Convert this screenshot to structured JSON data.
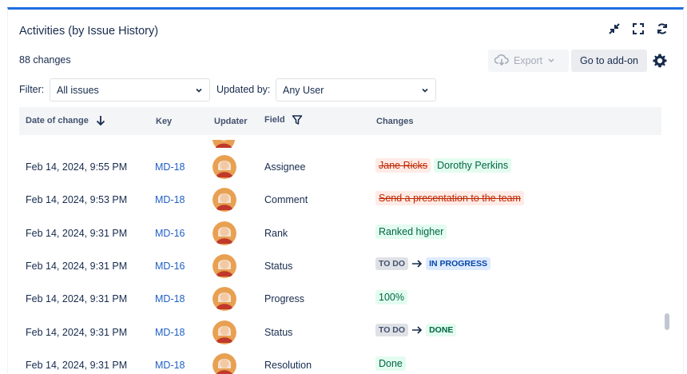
{
  "header": {
    "title": "Activities (by Issue History)",
    "icons": [
      "collapse-icon",
      "fullscreen-icon",
      "refresh-icon"
    ]
  },
  "summary": {
    "changes_count": "88 changes"
  },
  "toolbar": {
    "export_label": "Export",
    "addon_label": "Go to add-on"
  },
  "filters": {
    "filter_label": "Filter:",
    "filter_value": "All issues",
    "updated_by_label": "Updated by:",
    "updated_by_value": "Any User"
  },
  "table": {
    "columns": {
      "date": "Date of change",
      "key": "Key",
      "updater": "Updater",
      "field": "Field",
      "changes": "Changes"
    },
    "rows": [
      {
        "date": "Feb 14, 2024, 9:55 PM",
        "key": "MD-18",
        "field": "Assignee",
        "old": "Jane Ricks",
        "new": "Dorothy Perkins"
      },
      {
        "date": "Feb 14, 2024, 9:53 PM",
        "key": "MD-18",
        "field": "Comment",
        "old": "Send a presentation to the team"
      },
      {
        "date": "Feb 14, 2024, 9:31 PM",
        "key": "MD-16",
        "field": "Rank",
        "new": "Ranked higher"
      },
      {
        "date": "Feb 14, 2024, 9:31 PM",
        "key": "MD-16",
        "field": "Status",
        "from_status": "TO DO",
        "to_status": "IN PROGRESS"
      },
      {
        "date": "Feb 14, 2024, 9:31 PM",
        "key": "MD-18",
        "field": "Progress",
        "new": "100%"
      },
      {
        "date": "Feb 14, 2024, 9:31 PM",
        "key": "MD-18",
        "field": "Status",
        "from_status": "TO DO",
        "to_status": "DONE"
      },
      {
        "date": "Feb 14, 2024, 9:31 PM",
        "key": "MD-18",
        "field": "Resolution",
        "new": "Done"
      }
    ]
  },
  "colors": {
    "accent": "#1f6fe0",
    "link": "#1f5fc4",
    "removed_bg": "#ffebe6",
    "added_bg": "#e3fcef"
  }
}
